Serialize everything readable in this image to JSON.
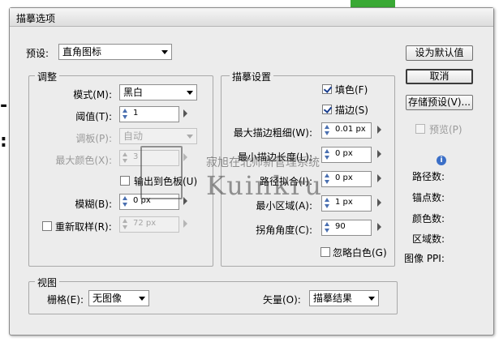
{
  "title": "描摹选项",
  "preset": {
    "label": "预设:",
    "value": "直角图标"
  },
  "adjust": {
    "title": "调整",
    "mode": {
      "label": "模式(M):",
      "value": "黑白"
    },
    "threshold": {
      "label": "阈值(T):",
      "value": "1"
    },
    "palette": {
      "label": "调板(P):",
      "value": "自动"
    },
    "max_colors": {
      "label": "最大颜色(X):",
      "value": "3"
    },
    "output_swatches": {
      "label": "输出到色板(U)",
      "checked": false
    },
    "blur": {
      "label": "模糊(B):",
      "value": "0 px"
    },
    "resample": {
      "label": "重新取样(R):",
      "value": "72 px",
      "checked": false
    }
  },
  "trace": {
    "title": "描摹设置",
    "fill": {
      "label": "填色(F)",
      "checked": true
    },
    "stroke": {
      "label": "描边(S)",
      "checked": true
    },
    "max_stroke_weight": {
      "label": "最大描边粗细(W):",
      "value": "0.01 px"
    },
    "min_stroke_length": {
      "label": "最小描边长度(L):",
      "value": "0 px"
    },
    "path_fitting": {
      "label": "路径拟合(I):",
      "value": "0 px"
    },
    "min_area": {
      "label": "最小区域(A):",
      "value": "1 px"
    },
    "corner_angle": {
      "label": "拐角角度(C):",
      "value": "90"
    },
    "ignore_white": {
      "label": "忽略白色(G)",
      "checked": false
    }
  },
  "view": {
    "title": "视图",
    "raster": {
      "label": "栅格(E):",
      "value": "无图像"
    },
    "vector": {
      "label": "矢量(O):",
      "value": "描摹结果"
    }
  },
  "buttons": {
    "set_default": "设为默认值",
    "cancel": "取消",
    "save_preset": "存储预设(V)..."
  },
  "preview": {
    "label": "预览(P)",
    "checked": false
  },
  "info": {
    "icon": "info-icon",
    "paths": "路径数:",
    "anchors": "锚点数:",
    "colors": "颜色数:",
    "areas": "区域数:",
    "ppi": "图像 PPI:"
  },
  "watermark": {
    "chinese": "寂旭在北师新管理系统",
    "latin": "Kuinkru"
  },
  "colors": {
    "dialog_bg": "#ececec",
    "accent_green": "#3aa935",
    "spin_arrow": "#4a6fb0"
  }
}
